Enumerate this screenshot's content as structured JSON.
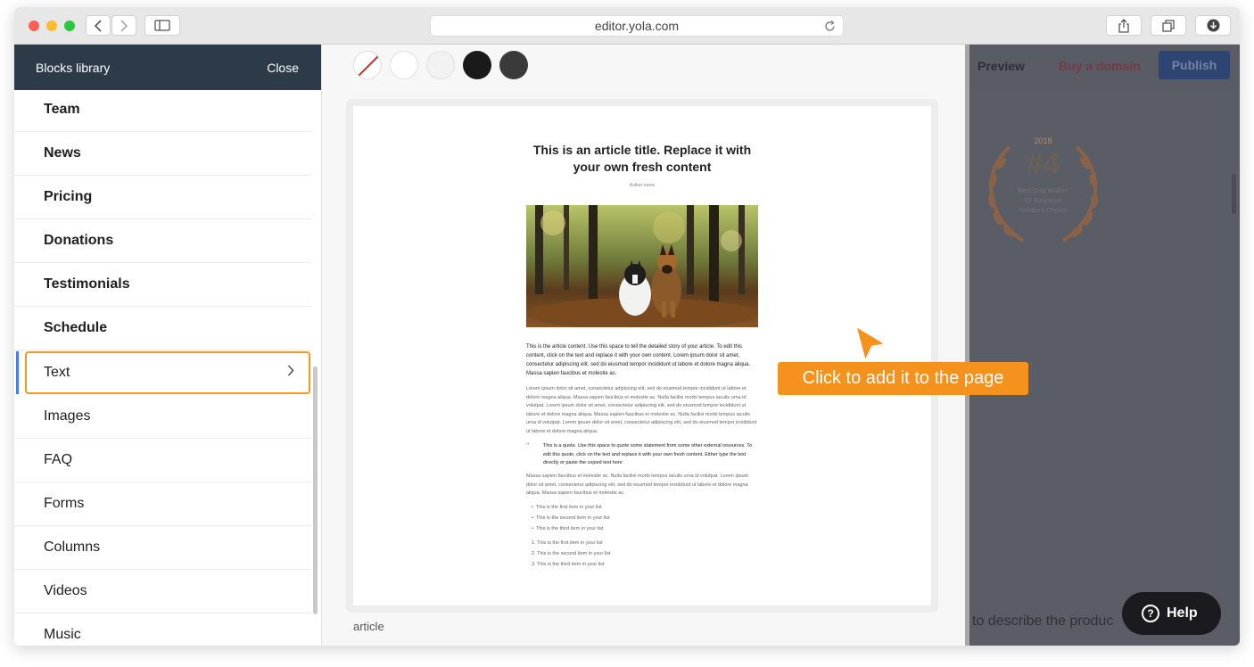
{
  "browser": {
    "url": "editor.yola.com"
  },
  "library": {
    "title": "Blocks library",
    "close_label": "Close",
    "items": [
      {
        "label": "Team"
      },
      {
        "label": "News"
      },
      {
        "label": "Pricing"
      },
      {
        "label": "Donations"
      },
      {
        "label": "Testimonials"
      },
      {
        "label": "Schedule"
      },
      {
        "label": "Text"
      },
      {
        "label": "Images"
      },
      {
        "label": "FAQ"
      },
      {
        "label": "Forms"
      },
      {
        "label": "Columns"
      },
      {
        "label": "Videos"
      },
      {
        "label": "Music"
      }
    ]
  },
  "swatches": [
    "none",
    "#ffffff",
    "#f2f2f2",
    "#1a1a1a",
    "#3a3a3a"
  ],
  "article": {
    "title": "This is an article title. Replace it with your own fresh content",
    "author": "Author name",
    "intro": "This is the article content. Use this space to tell the detailed story of your article. To edit this content, click on the text and replace it with your own content. Lorem ipsum dolor sit amet, consectetur adipiscing elit, sed do eiusmod tempor incididunt ut labore et dolore magna aliqua. Massa sapien faucibus et molestie ac.",
    "body": "Lorem ipsum dolor sit amet, consectetur adipiscing elit, sed do eiusmod tempor incididunt ut labore et dolore magna aliqua. Massa sapien faucibus et molestie ac. Nulla facilisi morbi tempus iaculis urna id volutpat. Lorem ipsum dolor sit amet, consectetur adipiscing elit, sed do eiusmod tempor incididunt ut labore et dolore magna aliqua. Massa sapien faucibus et molestie ac. Nulla facilisi morbi tempus iaculis urna id volutpat. Lorem ipsum dolor sit amet, consectetur adipiscing elit, sed do eiusmod tempor incididunt ut labore et dolore magna aliqua.",
    "quote": "This is a quote. Use this space to quote some statement from some other external resources. To edit this quote, click on the text and replace it with your own fresh content. Either type the text directly or paste the copied text here",
    "body2": "Massa sapien faucibus et molestie ac. Nulla facilisi morbi tempus iaculis urna id volutpat. Lorem ipsum dolor sit amet, consectetur adipiscing elit, sed do eiusmod tempor incididunt ut labore et dolore magna aliqua. Massa sapien faucibus et molestie ac.",
    "bullets": [
      "This is the first item in your list",
      "This is the second item in your list",
      "This is the third item in your list"
    ],
    "numbered": [
      "1. This is the first item in your list",
      "2. This is the second item in your list",
      "3. This is the third item in your list"
    ],
    "block_label": "article"
  },
  "site_preview": {
    "preview_label": "Preview",
    "buy_domain_label": "Buy a domain",
    "publish_label": "Publish",
    "badge_year": "2018",
    "badge_rank": "#4",
    "badge_line1": "Best Dog Walker",
    "badge_line2": "SF Examiner",
    "badge_line3": "Readers Choice",
    "desc_text": "to describe the produc",
    "help_label": "Help"
  },
  "tooltip": {
    "text": "Click to add it to the page"
  }
}
